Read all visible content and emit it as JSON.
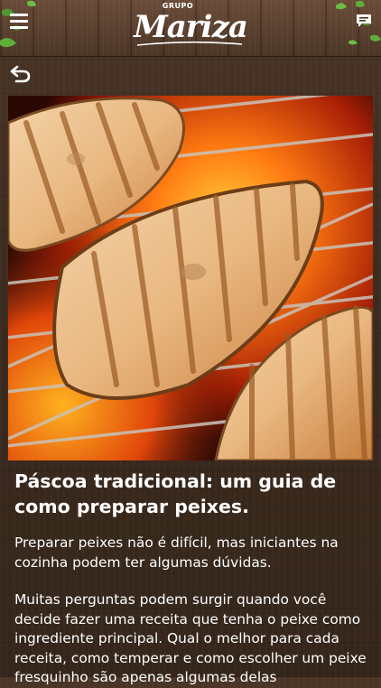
{
  "header": {
    "brand_prefix": "GRUPO",
    "brand_name": "Mariza",
    "menu_icon": "hamburger-menu-icon",
    "chat_icon": "chat-bubble-icon",
    "colors": {
      "wood": "#5b4130",
      "leaf": "#5fae3a"
    }
  },
  "navigation": {
    "back_icon": "back-arrow-icon"
  },
  "article": {
    "image": {
      "subject": "fish-steaks-on-grill"
    },
    "title": "Páscoa tradicional: um guia de como preparar peixes.",
    "paragraphs": [
      "Preparar peixes não é difícil, mas iniciantes na cozinha podem ter algumas dúvidas.",
      "Muitas perguntas podem surgir quando você decide fazer uma receita que tenha o peixe como ingrediente principal. Qual o melhor para cada receita, como temperar e como escolher um peixe fresquinho são apenas algumas delas"
    ]
  }
}
